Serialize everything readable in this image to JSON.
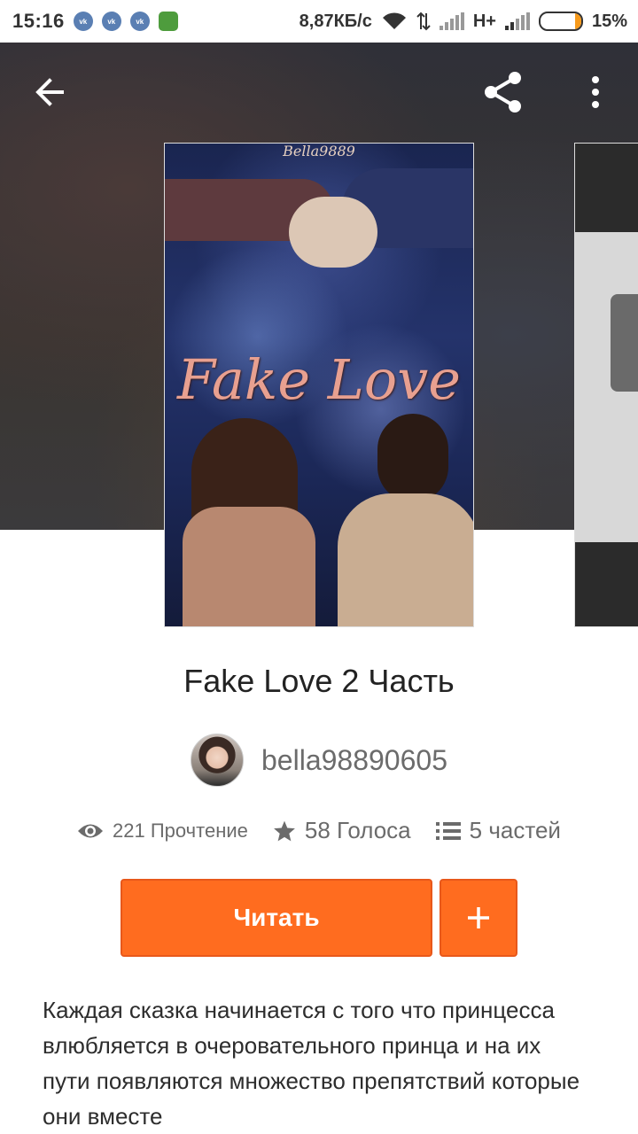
{
  "status_bar": {
    "time": "15:16",
    "notification_icons": [
      "vk-icon",
      "vk-icon",
      "vk-icon",
      "android-icon"
    ],
    "vk_label": "vk",
    "net_speed": "8,87КБ/с",
    "network_type": "H+",
    "battery_percent": "15%",
    "battery_level": 0.15,
    "battery_color": "#f79a1b"
  },
  "header": {
    "back_icon": "arrow-left-icon",
    "share_icon": "share-icon",
    "more_icon": "more-vertical-icon"
  },
  "cover": {
    "author_mark": "Bella9889",
    "title_text": "Fake Love"
  },
  "story": {
    "title": "Fake Love 2 Часть",
    "author": "bella98890605"
  },
  "stats": {
    "reads": "221 Прочтение",
    "votes": "58 Голоса",
    "parts": "5 частей",
    "icons": [
      "eye-icon",
      "star-icon",
      "list-icon"
    ]
  },
  "actions": {
    "read_label": "Читать",
    "add_icon": "plus-icon"
  },
  "description": "Каждая сказка начинается с того что принцесса влюбляется в очеровательного принца и на их пути появляются множество препятствий которые они вместе",
  "colors": {
    "accent": "#ff6c1f",
    "text_primary": "#222222",
    "text_secondary": "#6b6b6b"
  }
}
